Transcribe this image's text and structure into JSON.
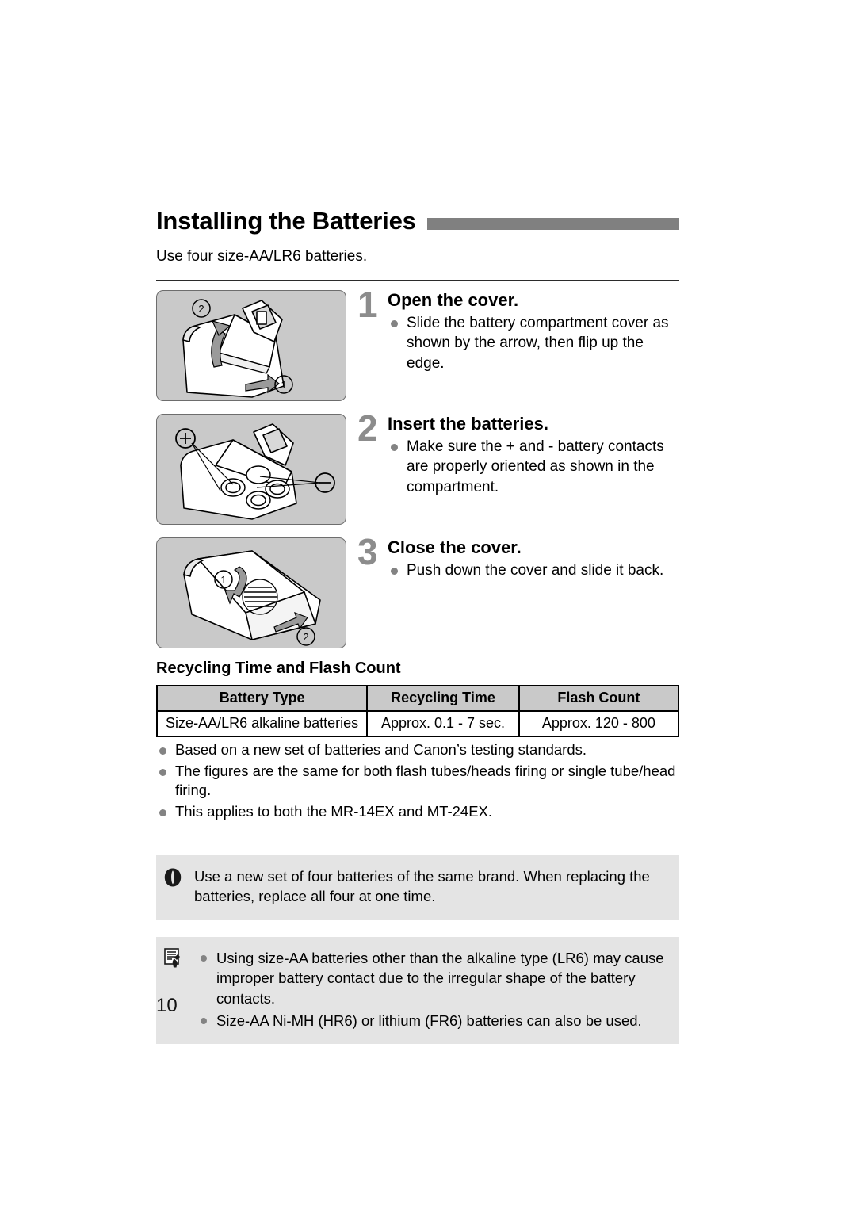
{
  "page": {
    "number": "10",
    "colors": {
      "header_bar": "#808080",
      "figure_bg": "#c9c9c9",
      "callout_bg": "#e4e4e4",
      "table_header_bg": "#c9c9c9",
      "step_number": "#8c8c8c",
      "bullet": "#838383"
    }
  },
  "header": {
    "title": "Installing the Batteries",
    "lead": "Use four size-AA/LR6 batteries."
  },
  "steps": [
    {
      "number": "1",
      "title": "Open the cover.",
      "figure_name": "figure-open-cover",
      "figure_callouts": [
        "1",
        "2"
      ],
      "bullets": [
        "Slide the battery compartment cover as shown by the arrow, then flip up the edge."
      ]
    },
    {
      "number": "2",
      "title": "Insert the batteries.",
      "figure_name": "figure-insert-batteries",
      "figure_callouts": [
        "+",
        "−"
      ],
      "bullets": [
        "Make sure the + and - battery contacts are properly oriented as shown in the compartment."
      ]
    },
    {
      "number": "3",
      "title": "Close the cover.",
      "figure_name": "figure-close-cover",
      "figure_callouts": [
        "1",
        "2"
      ],
      "bullets": [
        "Push down the cover and slide it back."
      ]
    }
  ],
  "spec_section": {
    "heading": "Recycling Time and Flash Count",
    "table": {
      "columns": [
        "Battery Type",
        "Recycling Time",
        "Flash Count"
      ],
      "rows": [
        [
          "Size-AA/LR6 alkaline batteries",
          "Approx. 0.1 - 7 sec.",
          "Approx. 120 - 800"
        ]
      ]
    },
    "notes": [
      "Based on a new set of batteries and Canon’s testing standards.",
      "The figures are the same for both flash tubes/heads firing or single tube/head firing.",
      "This applies to both the MR-14EX and MT-24EX."
    ]
  },
  "callouts": {
    "caution": {
      "icon": "caution-icon",
      "text": "Use a new set of four batteries of the same brand. When replacing the batteries, replace all four at one time."
    },
    "note": {
      "icon": "note-icon",
      "bullets": [
        "Using size-AA batteries other than the alkaline type (LR6) may cause improper battery contact due to the irregular shape of the battery contacts.",
        "Size-AA Ni-MH (HR6) or lithium (FR6) batteries can also be used."
      ]
    }
  }
}
